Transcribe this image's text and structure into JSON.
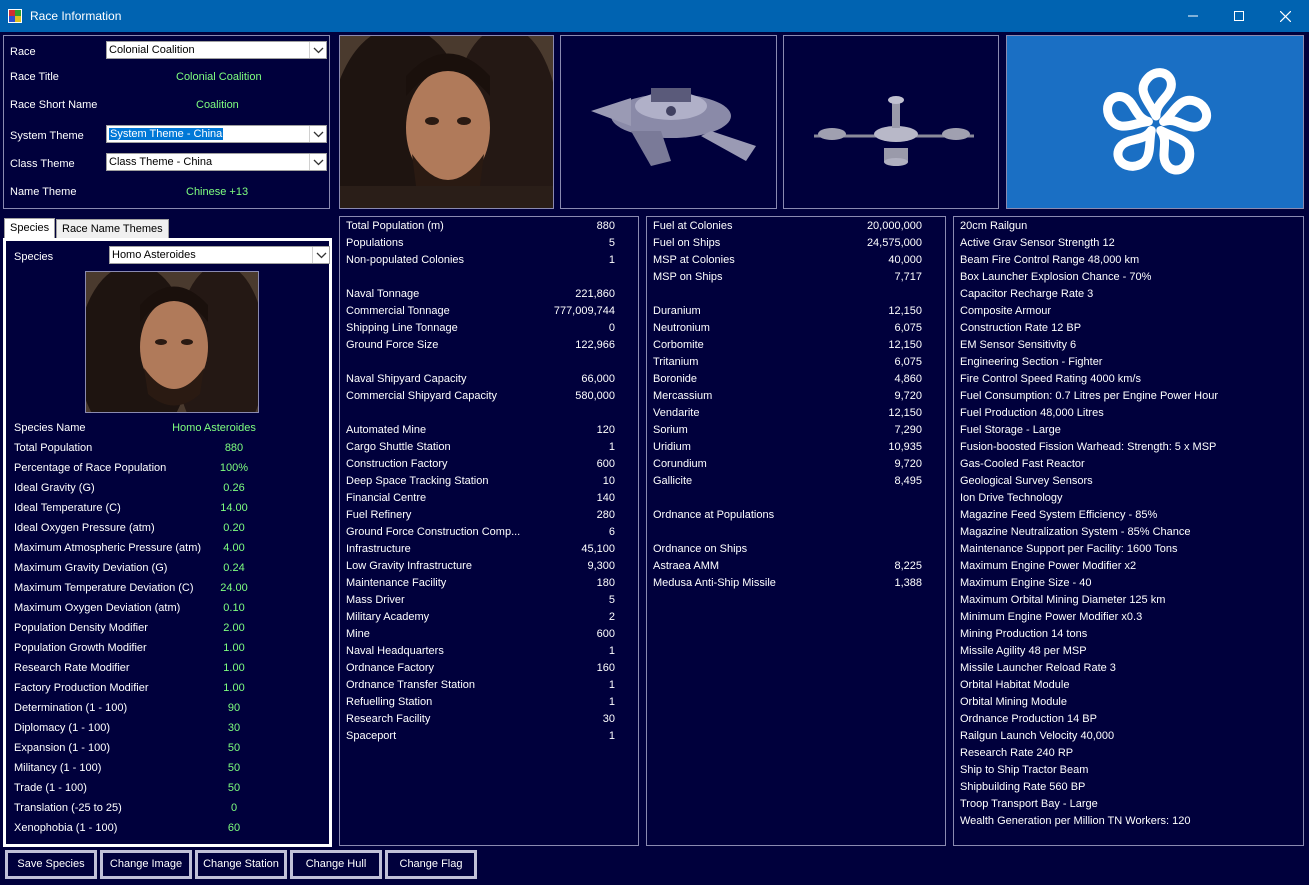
{
  "window": {
    "title": "Race Information"
  },
  "race": {
    "race_label": "Race",
    "race_value": "Colonial Coalition",
    "title_label": "Race Title",
    "title_value": "Colonial Coalition",
    "short_label": "Race Short Name",
    "short_value": "Coalition",
    "system_theme_label": "System Theme",
    "system_theme_value": "System Theme - China",
    "class_theme_label": "Class Theme",
    "class_theme_value": "Class Theme - China",
    "name_theme_label": "Name Theme",
    "name_theme_value": "Chinese +13"
  },
  "tabs": [
    "Species",
    "Race Name Themes"
  ],
  "species": {
    "species_label": "Species",
    "species_value": "Homo Asteroides",
    "rows": [
      {
        "label": "Species Name",
        "value": "Homo Asteroides"
      },
      {
        "label": "Total Population",
        "value": "880"
      },
      {
        "label": "Percentage of Race Population",
        "value": "100%"
      },
      {
        "label": "Ideal Gravity (G)",
        "value": "0.26"
      },
      {
        "label": "Ideal Temperature (C)",
        "value": "14.00"
      },
      {
        "label": "Ideal Oxygen Pressure (atm)",
        "value": "0.20"
      },
      {
        "label": "Maximum Atmospheric Pressure (atm)",
        "value": "4.00"
      },
      {
        "label": "Maximum Gravity Deviation (G)",
        "value": "0.24"
      },
      {
        "label": "Maximum Temperature Deviation (C)",
        "value": "24.00"
      },
      {
        "label": "Maximum Oxygen Deviation (atm)",
        "value": "0.10"
      },
      {
        "label": "Population Density Modifier",
        "value": "2.00"
      },
      {
        "label": "Population Growth Modifier",
        "value": "1.00"
      },
      {
        "label": "Research Rate Modifier",
        "value": "1.00"
      },
      {
        "label": "Factory Production Modifier",
        "value": "1.00"
      },
      {
        "label": "Determination (1 - 100)",
        "value": "90"
      },
      {
        "label": "Diplomacy (1 - 100)",
        "value": "30"
      },
      {
        "label": "Expansion (1 - 100)",
        "value": "50"
      },
      {
        "label": "Militancy (1 - 100)",
        "value": "50"
      },
      {
        "label": "Trade (1 - 100)",
        "value": "50"
      },
      {
        "label": "Translation (-25 to 25)",
        "value": "0"
      },
      {
        "label": "Xenophobia (1 - 100)",
        "value": "60"
      }
    ]
  },
  "summary": [
    {
      "label": "Total Population (m)",
      "value": "880"
    },
    {
      "label": "Populations",
      "value": "5"
    },
    {
      "label": "Non-populated Colonies",
      "value": "1"
    },
    {
      "label": "",
      "value": ""
    },
    {
      "label": "Naval Tonnage",
      "value": "221,860"
    },
    {
      "label": "Commercial Tonnage",
      "value": "777,009,744"
    },
    {
      "label": "Shipping Line Tonnage",
      "value": "0"
    },
    {
      "label": "Ground Force Size",
      "value": "122,966"
    },
    {
      "label": "",
      "value": ""
    },
    {
      "label": "Naval Shipyard Capacity",
      "value": "66,000"
    },
    {
      "label": "Commercial Shipyard Capacity",
      "value": "580,000"
    },
    {
      "label": "",
      "value": ""
    },
    {
      "label": "Automated Mine",
      "value": "120"
    },
    {
      "label": "Cargo Shuttle Station",
      "value": "1"
    },
    {
      "label": "Construction Factory",
      "value": "600"
    },
    {
      "label": "Deep Space Tracking Station",
      "value": "10"
    },
    {
      "label": "Financial Centre",
      "value": "140"
    },
    {
      "label": "Fuel Refinery",
      "value": "280"
    },
    {
      "label": "Ground Force Construction Comp...",
      "value": "6"
    },
    {
      "label": "Infrastructure",
      "value": "45,100"
    },
    {
      "label": "Low Gravity Infrastructure",
      "value": "9,300"
    },
    {
      "label": "Maintenance Facility",
      "value": "180"
    },
    {
      "label": "Mass Driver",
      "value": "5"
    },
    {
      "label": "Military Academy",
      "value": "2"
    },
    {
      "label": "Mine",
      "value": "600"
    },
    {
      "label": "Naval Headquarters",
      "value": "1"
    },
    {
      "label": "Ordnance Factory",
      "value": "160"
    },
    {
      "label": "Ordnance Transfer Station",
      "value": "1"
    },
    {
      "label": "Refuelling Station",
      "value": "1"
    },
    {
      "label": "Research Facility",
      "value": "30"
    },
    {
      "label": "Spaceport",
      "value": "1"
    }
  ],
  "resources": [
    {
      "label": "Fuel at Colonies",
      "value": "20,000,000"
    },
    {
      "label": "Fuel on Ships",
      "value": "24,575,000"
    },
    {
      "label": "MSP at Colonies",
      "value": "40,000"
    },
    {
      "label": "MSP on Ships",
      "value": "7,717"
    },
    {
      "label": "",
      "value": ""
    },
    {
      "label": "Duranium",
      "value": "12,150"
    },
    {
      "label": "Neutronium",
      "value": "6,075"
    },
    {
      "label": "Corbomite",
      "value": "12,150"
    },
    {
      "label": "Tritanium",
      "value": "6,075"
    },
    {
      "label": "Boronide",
      "value": "4,860"
    },
    {
      "label": "Mercassium",
      "value": "9,720"
    },
    {
      "label": "Vendarite",
      "value": "12,150"
    },
    {
      "label": "Sorium",
      "value": "7,290"
    },
    {
      "label": "Uridium",
      "value": "10,935"
    },
    {
      "label": "Corundium",
      "value": "9,720"
    },
    {
      "label": "Gallicite",
      "value": "8,495"
    },
    {
      "label": "",
      "value": ""
    },
    {
      "label": "Ordnance at Populations",
      "value": ""
    },
    {
      "label": "",
      "value": ""
    },
    {
      "label": "Ordnance on Ships",
      "value": ""
    },
    {
      "label": "Astraea AMM",
      "value": "8,225"
    },
    {
      "label": "Medusa Anti-Ship Missile",
      "value": "1,388"
    }
  ],
  "tech": [
    "20cm Railgun",
    "Active Grav Sensor Strength 12",
    "Beam Fire Control Range 48,000 km",
    "Box Launcher Explosion Chance - 70%",
    "Capacitor Recharge Rate 3",
    "Composite Armour",
    "Construction Rate 12 BP",
    "EM Sensor Sensitivity 6",
    "Engineering Section - Fighter",
    "Fire Control Speed Rating 4000 km/s",
    "Fuel Consumption: 0.7 Litres per Engine Power Hour",
    "Fuel Production 48,000 Litres",
    "Fuel Storage - Large",
    "Fusion-boosted Fission Warhead: Strength: 5 x MSP",
    "Gas-Cooled Fast Reactor",
    "Geological Survey Sensors",
    "Ion Drive Technology",
    "Magazine Feed System Efficiency - 85%",
    "Magazine Neutralization System - 85% Chance",
    "Maintenance Support per Facility: 1600 Tons",
    "Maximum Engine Power Modifier x2",
    "Maximum Engine Size - 40",
    "Maximum Orbital Mining Diameter 125 km",
    "Minimum Engine Power Modifier x0.3",
    "Mining Production 14 tons",
    "Missile Agility 48 per MSP",
    "Missile Launcher Reload Rate 3",
    "Orbital Habitat Module",
    "Orbital Mining Module",
    "Ordnance Production 14 BP",
    "Railgun Launch Velocity 40,000",
    "Research Rate 240 RP",
    "Ship to Ship Tractor Beam",
    "Shipbuilding Rate 560 BP",
    "Troop Transport Bay - Large",
    "Wealth Generation per Million TN Workers: 120"
  ],
  "buttons": {
    "save_species": "Save Species",
    "change_image": "Change Image",
    "change_station": "Change Station",
    "change_hull": "Change Hull",
    "change_flag": "Change Flag"
  },
  "colors": {
    "title_bar": "#0063b1",
    "background": "#00003c",
    "value_green": "#7fff7f",
    "flag_blue": "#1a6fc4"
  }
}
